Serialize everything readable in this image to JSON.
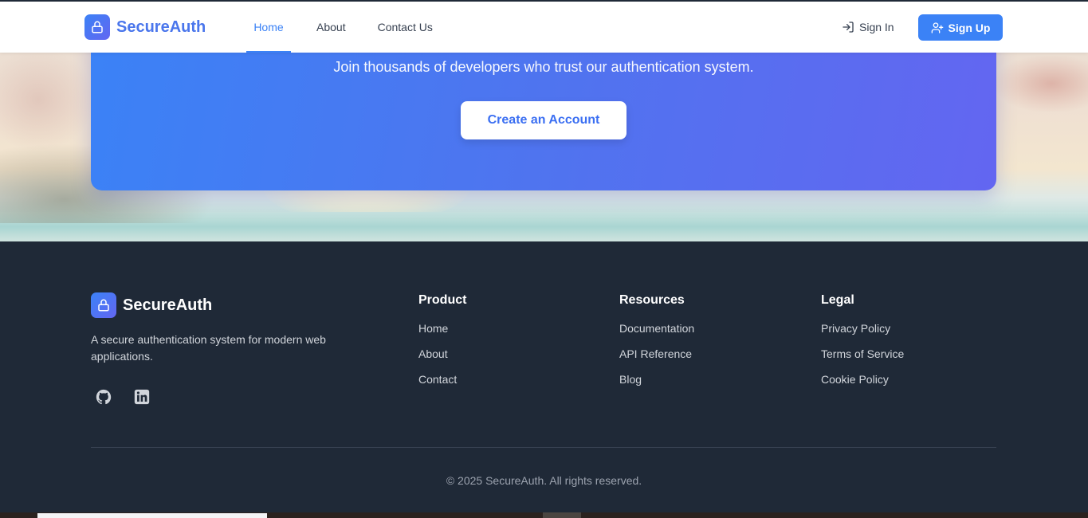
{
  "header": {
    "brand": "SecureAuth",
    "nav": {
      "home": "Home",
      "about": "About",
      "contact": "Contact Us"
    },
    "signin_label": "Sign In",
    "signup_label": "Sign Up"
  },
  "cta": {
    "subtitle": "Join thousands of developers who trust our authentication system.",
    "button_label": "Create an Account"
  },
  "footer": {
    "brand": "SecureAuth",
    "description": "A secure authentication system for modern web applications.",
    "social": [
      "github-icon",
      "linkedin-icon"
    ],
    "columns": {
      "product": {
        "title": "Product",
        "links": [
          "Home",
          "About",
          "Contact"
        ]
      },
      "resources": {
        "title": "Resources",
        "links": [
          "Documentation",
          "API Reference",
          "Blog"
        ]
      },
      "legal": {
        "title": "Legal",
        "links": [
          "Privacy Policy",
          "Terms of Service",
          "Cookie Policy"
        ]
      }
    },
    "copyright": "© 2025 SecureAuth. All rights reserved."
  },
  "colors": {
    "primary": "#3b82f6",
    "accent": "#6366f1",
    "footer_bg": "#1f2937"
  }
}
